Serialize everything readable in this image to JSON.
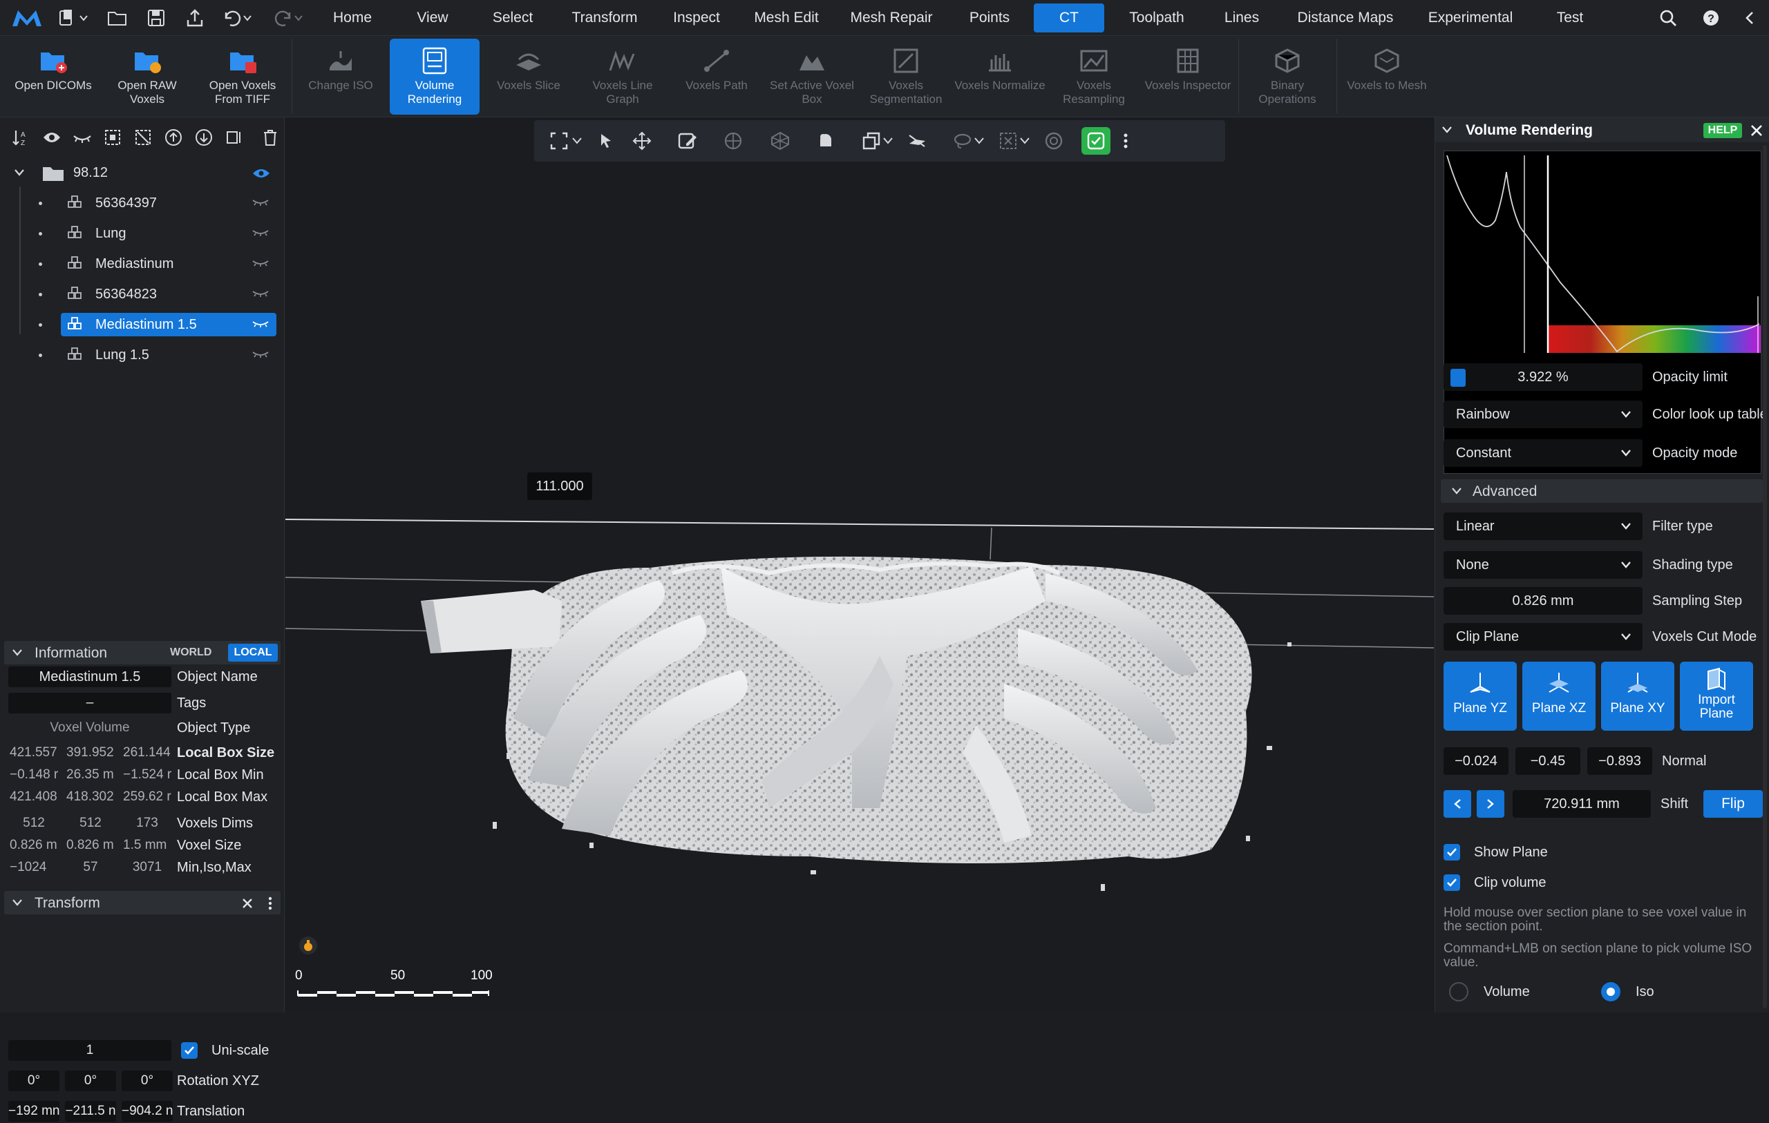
{
  "menubar": {
    "items": [
      {
        "label": "Home",
        "active": false
      },
      {
        "label": "View",
        "active": false
      },
      {
        "label": "Select",
        "active": false
      },
      {
        "label": "Transform",
        "active": false
      },
      {
        "label": "Inspect",
        "active": false
      },
      {
        "label": "Mesh Edit",
        "active": false
      },
      {
        "label": "Mesh Repair",
        "active": false
      },
      {
        "label": "Points",
        "active": false
      },
      {
        "label": "CT",
        "active": true
      },
      {
        "label": "Toolpath",
        "active": false
      },
      {
        "label": "Lines",
        "active": false
      },
      {
        "label": "Distance Maps",
        "active": false
      },
      {
        "label": "Experimental",
        "active": false
      },
      {
        "label": "Test",
        "active": false
      }
    ],
    "accent": "#1476d9"
  },
  "ribbon": {
    "buttons": [
      {
        "label": "Open DICOMs",
        "icon": "open-dicoms-icon"
      },
      {
        "label": "Open RAW Voxels",
        "icon": "open-raw-voxels-icon"
      },
      {
        "label": "Open Voxels From TIFF",
        "icon": "open-tiff-icon"
      },
      {
        "label": "Change ISO",
        "icon": "change-iso-icon"
      },
      {
        "label": "Volume Rendering",
        "icon": "volume-rendering-icon"
      },
      {
        "label": "Voxels Slice",
        "icon": "voxels-slice-icon"
      },
      {
        "label": "Voxels Line Graph",
        "icon": "line-graph-icon"
      },
      {
        "label": "Voxels Path",
        "icon": "voxels-path-icon"
      },
      {
        "label": "Set Active Voxel Box",
        "icon": "voxel-box-icon"
      },
      {
        "label": "Voxels Segmentation",
        "icon": "segmentation-icon"
      },
      {
        "label": "Voxels Normalize",
        "icon": "normalize-icon"
      },
      {
        "label": "Voxels Resampling",
        "icon": "resampling-icon"
      },
      {
        "label": "Voxels Inspector",
        "icon": "inspector-icon"
      },
      {
        "label": "Binary Operations",
        "icon": "binary-ops-icon"
      },
      {
        "label": "Voxels to Mesh",
        "icon": "voxels-to-mesh-icon"
      }
    ]
  },
  "scene": {
    "root": "98.12",
    "objects": [
      "56364397",
      "Lung",
      "Mediastinum",
      "56364823",
      "Mediastinum 1.5",
      "Lung 1.5"
    ],
    "selected": "Mediastinum 1.5"
  },
  "information": {
    "title": "Information",
    "world_label": "WORLD",
    "local_label": "LOCAL",
    "object_name": "Mediastinum 1.5",
    "object_name_label": "Object Name",
    "tags": "–",
    "tags_label": "Tags",
    "object_type": "Voxel Volume",
    "object_type_label": "Object Type",
    "rows": [
      {
        "label": "Local Box Size",
        "values": [
          "421.557",
          "391.952",
          "261.144"
        ]
      },
      {
        "label": "Local Box Min",
        "values": [
          "−0.148 r",
          "26.35 m",
          "−1.524 r"
        ]
      },
      {
        "label": "Local Box Max",
        "values": [
          "421.408",
          "418.302",
          "259.62 r"
        ]
      },
      {
        "label": "Voxels Dims",
        "values": [
          "512",
          "512",
          "173"
        ]
      },
      {
        "label": "Voxel Size",
        "values": [
          "0.826 m",
          "0.826 m",
          "1.5 mm"
        ]
      },
      {
        "label": "Min,Iso,Max",
        "values": [
          "−1024",
          "57",
          "3071"
        ]
      }
    ]
  },
  "transform": {
    "title": "Transform",
    "scale": "1",
    "uniscale_label": "Uni-scale",
    "rotation": [
      "0°",
      "0°",
      "0°"
    ],
    "rotation_label": "Rotation XYZ",
    "translation": [
      "−192 mn",
      "−211.5 n",
      "−904.2 n"
    ],
    "translation_label": "Translation"
  },
  "viewport": {
    "value_tooltip": "111.000",
    "scale_labels": [
      "0",
      "50",
      "100"
    ]
  },
  "volume_panel": {
    "title": "Volume Rendering",
    "help": "HELP",
    "opacity_limit": "3.922 %",
    "opacity_limit_label": "Opacity limit",
    "color_lut": "Rainbow",
    "color_lut_label": "Color look up table",
    "opacity_mode": "Constant",
    "opacity_mode_label": "Opacity mode",
    "advanced": "Advanced",
    "filter_type": "Linear",
    "filter_type_label": "Filter type",
    "shading_type": "None",
    "shading_type_label": "Shading type",
    "sampling_step": "0.826 mm",
    "sampling_step_label": "Sampling Step",
    "cut_mode": "Clip Plane",
    "cut_mode_label": "Voxels Cut Mode",
    "plane_buttons": [
      "Plane YZ",
      "Plane XZ",
      "Plane XY",
      "Import Plane"
    ],
    "normal": [
      "−0.024",
      "−0.45",
      "−0.893"
    ],
    "normal_label": "Normal",
    "shift": "720.911 mm",
    "shift_label": "Shift",
    "flip": "Flip",
    "show_plane": "Show Plane",
    "clip_volume": "Clip volume",
    "hint1": "Hold mouse over section plane to see voxel value in the section point.",
    "hint2": "Command+LMB on section plane to pick volume ISO value.",
    "radio_volume": "Volume",
    "radio_iso": "Iso",
    "radio_selected": "Iso"
  }
}
